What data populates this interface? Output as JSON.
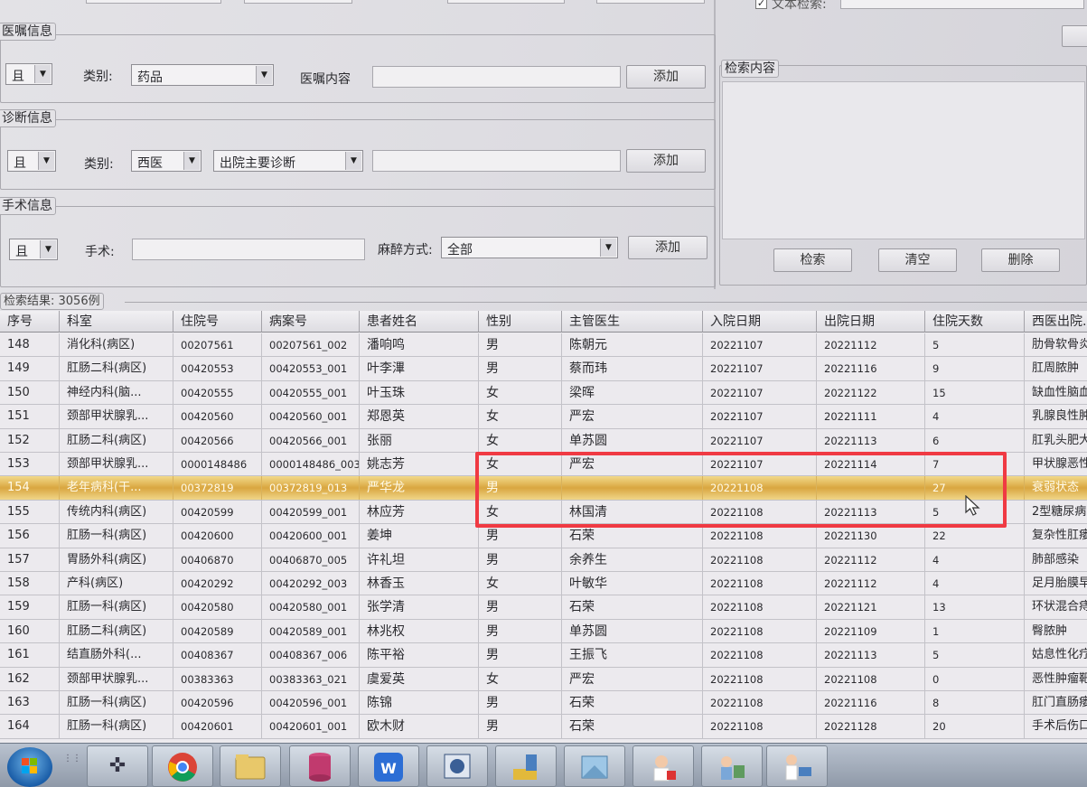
{
  "order_section": {
    "title": "医嘱信息",
    "logic": "且",
    "category_label": "类别:",
    "category_value": "药品",
    "content_label": "医嘱内容",
    "add_label": "添加"
  },
  "diagnosis_section": {
    "title": "诊断信息",
    "logic": "且",
    "category_label": "类别:",
    "category_value": "西医",
    "type_value": "出院主要诊断",
    "add_label": "添加"
  },
  "surgery_section": {
    "title": "手术信息",
    "logic": "且",
    "surgery_label": "手术:",
    "anesthesia_label": "麻醉方式:",
    "anesthesia_value": "全部",
    "add_label": "添加"
  },
  "text_search": {
    "label": "文本检索:",
    "checked": true
  },
  "search_content": {
    "title": "检索内容",
    "search_label": "检索",
    "clear_label": "清空",
    "delete_label": "删除"
  },
  "result_label": "检索结果: 3056例",
  "table": {
    "columns": [
      "序号",
      "科室",
      "住院号",
      "病案号",
      "患者姓名",
      "性别",
      "主管医生",
      "入院日期",
      "出院日期",
      "住院天数",
      "西医出院..."
    ],
    "rows": [
      [
        "148",
        "消化科(病区)",
        "00207561",
        "00207561_002",
        "潘响鸣",
        "男",
        "陈朝元",
        "20221107",
        "20221112",
        "5",
        "肋骨软骨炎"
      ],
      [
        "149",
        "肛肠二科(病区)",
        "00420553",
        "00420553_001",
        "叶李滭",
        "男",
        "蔡而玮",
        "20221107",
        "20221116",
        "9",
        "肛周脓肿"
      ],
      [
        "150",
        "神经内科(脑...",
        "00420555",
        "00420555_001",
        "叶玉珠",
        "女",
        "梁晖",
        "20221107",
        "20221122",
        "15",
        "缺血性脑血"
      ],
      [
        "151",
        "颈部甲状腺乳...",
        "00420560",
        "00420560_001",
        "郑恩英",
        "女",
        "严宏",
        "20221107",
        "20221111",
        "4",
        "乳腺良性肿"
      ],
      [
        "152",
        "肛肠二科(病区)",
        "00420566",
        "00420566_001",
        "张丽",
        "女",
        "单苏圆",
        "20221107",
        "20221113",
        "6",
        "肛乳头肥大"
      ],
      [
        "153",
        "颈部甲状腺乳...",
        "0000148486",
        "0000148486_003",
        "姚志芳",
        "女",
        "严宏",
        "20221107",
        "20221114",
        "7",
        "甲状腺恶性"
      ],
      [
        "154",
        "老年病科(干...",
        "00372819",
        "00372819_013",
        "严华龙",
        "男",
        "",
        "20221108",
        "",
        "27",
        "衰弱状态"
      ],
      [
        "155",
        "传统内科(病区)",
        "00420599",
        "00420599_001",
        "林应芳",
        "女",
        "林国清",
        "20221108",
        "20221113",
        "5",
        "2型糖尿病"
      ],
      [
        "156",
        "肛肠一科(病区)",
        "00420600",
        "00420600_001",
        "姜坤",
        "男",
        "石荣",
        "20221108",
        "20221130",
        "22",
        "复杂性肛瘘"
      ],
      [
        "157",
        "胃肠外科(病区)",
        "00406870",
        "00406870_005",
        "许礼坦",
        "男",
        "余养生",
        "20221108",
        "20221112",
        "4",
        "肺部感染"
      ],
      [
        "158",
        "产科(病区)",
        "00420292",
        "00420292_003",
        "林香玉",
        "女",
        "叶敏华",
        "20221108",
        "20221112",
        "4",
        "足月胎膜早"
      ],
      [
        "159",
        "肛肠一科(病区)",
        "00420580",
        "00420580_001",
        "张学清",
        "男",
        "石荣",
        "20221108",
        "20221121",
        "13",
        "环状混合痔"
      ],
      [
        "160",
        "肛肠二科(病区)",
        "00420589",
        "00420589_001",
        "林兆权",
        "男",
        "单苏圆",
        "20221108",
        "20221109",
        "1",
        "臀脓肿"
      ],
      [
        "161",
        "结直肠外科(...",
        "00408367",
        "00408367_006",
        "陈平裕",
        "男",
        "王振飞",
        "20221108",
        "20221113",
        "5",
        "姑息性化疗"
      ],
      [
        "162",
        "颈部甲状腺乳...",
        "00383363",
        "00383363_021",
        "虞爱英",
        "女",
        "严宏",
        "20221108",
        "20221108",
        "0",
        "恶性肿瘤靶"
      ],
      [
        "163",
        "肛肠一科(病区)",
        "00420596",
        "00420596_001",
        "陈锦",
        "男",
        "石荣",
        "20221108",
        "20221116",
        "8",
        "肛门直肠瘘"
      ],
      [
        "164",
        "肛肠一科(病区)",
        "00420601",
        "00420601_001",
        "欧木财",
        "男",
        "石荣",
        "20221108",
        "20221128",
        "20",
        "手术后伤口"
      ]
    ],
    "selected_row_index": 6
  },
  "taskbar": {
    "items": [
      "start-orb-icon",
      "grid-icon",
      "compass-icon",
      "chrome-icon",
      "folder-icon",
      "database-icon",
      "wps-icon",
      "sql-icon",
      "sql-tools-icon",
      "image-app-icon",
      "nurse-icon",
      "doctor-chart-icon",
      "doctor-computer-icon"
    ]
  }
}
